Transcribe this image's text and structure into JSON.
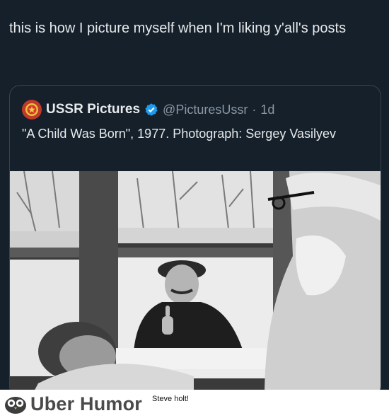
{
  "tweet": {
    "text": "this is how I picture myself when I'm liking y'all's posts"
  },
  "quote": {
    "author_name": "USSR Pictures",
    "handle": "@PicturesUssr",
    "separator": "·",
    "time": "1d",
    "text": "\"A Child Was Born\", 1977. Photograph: Sergey Vasilyev",
    "avatar_icon": "ussr-emblem-icon",
    "verified_icon": "verified-badge-icon",
    "verified_color": "#1d9bf0"
  },
  "footer": {
    "brand": "Uber Humor",
    "caption": "Steve holt!",
    "logo_icon": "owl-icon"
  },
  "colors": {
    "background": "#15202b",
    "text": "#e7e9ea",
    "muted": "#8b98a5",
    "border": "#38444d"
  }
}
